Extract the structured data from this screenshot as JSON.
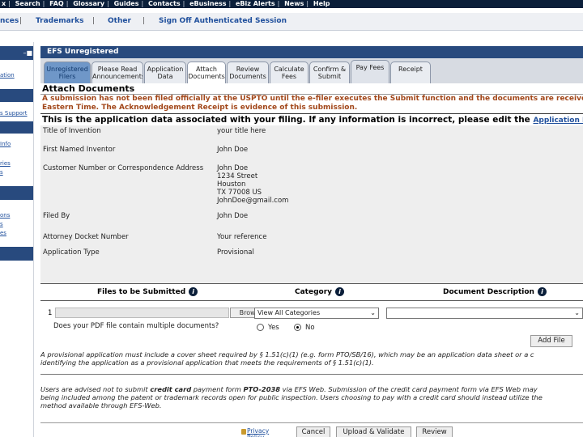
{
  "topnav": {
    "items": [
      "x",
      "Search",
      "FAQ",
      "Glossary",
      "Guides",
      "Contacts",
      "eBusiness",
      "eBiz Alerts",
      "News",
      "Help"
    ]
  },
  "subnav": {
    "items": [
      "nces",
      "Trademarks",
      "Other",
      "Sign Off Authenticated Session"
    ]
  },
  "sidebar": {
    "min_icon": "–■",
    "links": [
      "ation",
      "s Support",
      "Info",
      "ries",
      "s",
      "ons",
      "s",
      "es"
    ]
  },
  "panel": {
    "title": "EFS Unregistered"
  },
  "tabs": [
    {
      "label": "Unregistered Filers"
    },
    {
      "label": "Please Read Announcements"
    },
    {
      "label": "Application Data"
    },
    {
      "label": "Attach Documents"
    },
    {
      "label": "Review Documents"
    },
    {
      "label": "Calculate Fees"
    },
    {
      "label": "Confirm & Submit"
    },
    {
      "label": "Pay Fees"
    },
    {
      "label": "Receipt"
    }
  ],
  "section": {
    "title": "Attach Documents",
    "warning_line1": "A submission has not been filed officially at the USPTO until the e-filer executes the Submit function and the documents are received",
    "warning_line2": "Eastern Time. The Acknowledgement Receipt is evidence of this submission.",
    "info_text": "This is the application data associated with your filing. If any information is incorrect, please edit the ",
    "info_link": "Application Data"
  },
  "application_data": {
    "title_label": "Title of Invention",
    "title_value": "your title here",
    "inventor_label": "First Named Inventor",
    "inventor_value": "John Doe",
    "customer_label": "Customer Number or Correspondence Address",
    "address": [
      "John Doe",
      "1234 Street",
      "Houston",
      "TX 77008 US",
      "JohnDoe@gmail.com"
    ],
    "filed_by_label": "Filed By",
    "filed_by_value": "John Doe",
    "docket_label": "Attorney Docket Number",
    "docket_value": "Your reference",
    "type_label": "Application Type",
    "type_value": "Provisional"
  },
  "files": {
    "col_files": "Files to be Submitted",
    "col_category": "Category",
    "col_description": "Document Description",
    "row_number": "1",
    "browse_label": "Browse...",
    "category_selected": "View All Categories",
    "description_selected": "",
    "pdf_question": "Does your PDF file contain multiple documents?",
    "yes_label": "Yes",
    "no_label": "No",
    "add_file_label": "Add File"
  },
  "notes": {
    "provisional_line1": "A provisional application must include a cover sheet required by § 1.51(c)(1) (e.g. form PTO/SB/16), which may be an application data sheet or a c",
    "provisional_line2": "identifying the application as a provisional application that meets the requirements of § 1.51(c)(1).",
    "cc_pre": "Users are advised not to submit ",
    "cc_bold1": "credit card",
    "cc_mid": " payment form ",
    "cc_bold2": "PTO-2038",
    "cc_post": " via EFS Web. Submission of the credit card payment form via EFS Web may",
    "cc_line2": "being included among the patent or trademark records open for public inspection. Users choosing to pay with a credit card should instead utilize the",
    "cc_line3": "method available through EFS-Web."
  },
  "footer": {
    "privacy": "Privacy Policy",
    "cancel": "Cancel",
    "upload": "Upload & Validate",
    "review": "Review"
  },
  "colors": {
    "navy": "#0b1f3a",
    "panel_blue": "#284a7e",
    "link_blue": "#1f4f9c",
    "warning_brown": "#a2471a"
  }
}
